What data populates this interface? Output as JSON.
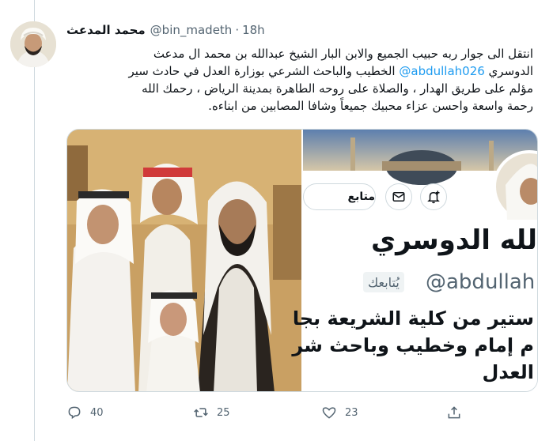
{
  "tweet": {
    "display_name": "محمد المدعث",
    "handle": "@bin_madeth",
    "time": "18h",
    "text_line1": "انتقل الى جوار ربه حبيب الجميع والابن البار  الشيخ عبدالله بن محمد ال مدعث",
    "text_line2_before": "الدوسري ",
    "mention": "@abdullah026",
    "text_line2_after": " الخطيب والباحث الشرعي بوزارة العدل في حادث سير",
    "text_line3": "مؤلم على طريق الهدار ، والصلاة على روحه الطاهرة بمدينة الرياض ، رحمك الله",
    "text_line4": "رحمة واسعة واحسن عزاء محبيك جميعاً وشافا المصابين من ابناءه."
  },
  "media": {
    "profile_card": {
      "follow_button": "متابع",
      "name": "الله الدوسري",
      "handle": "@abdullah",
      "follows_you": "يُتابعك",
      "bio_line1": "ستير من كلية الشريعة بجا",
      "bio_line2": "م إمام وخطيب وباحث شر",
      "bio_line3": "العدل"
    }
  },
  "actions": {
    "replies": "40",
    "retweets": "25",
    "likes": "23"
  },
  "colors": {
    "accent": "#1d9bf0",
    "secondary_text": "#536471",
    "border": "#cfd9de"
  }
}
